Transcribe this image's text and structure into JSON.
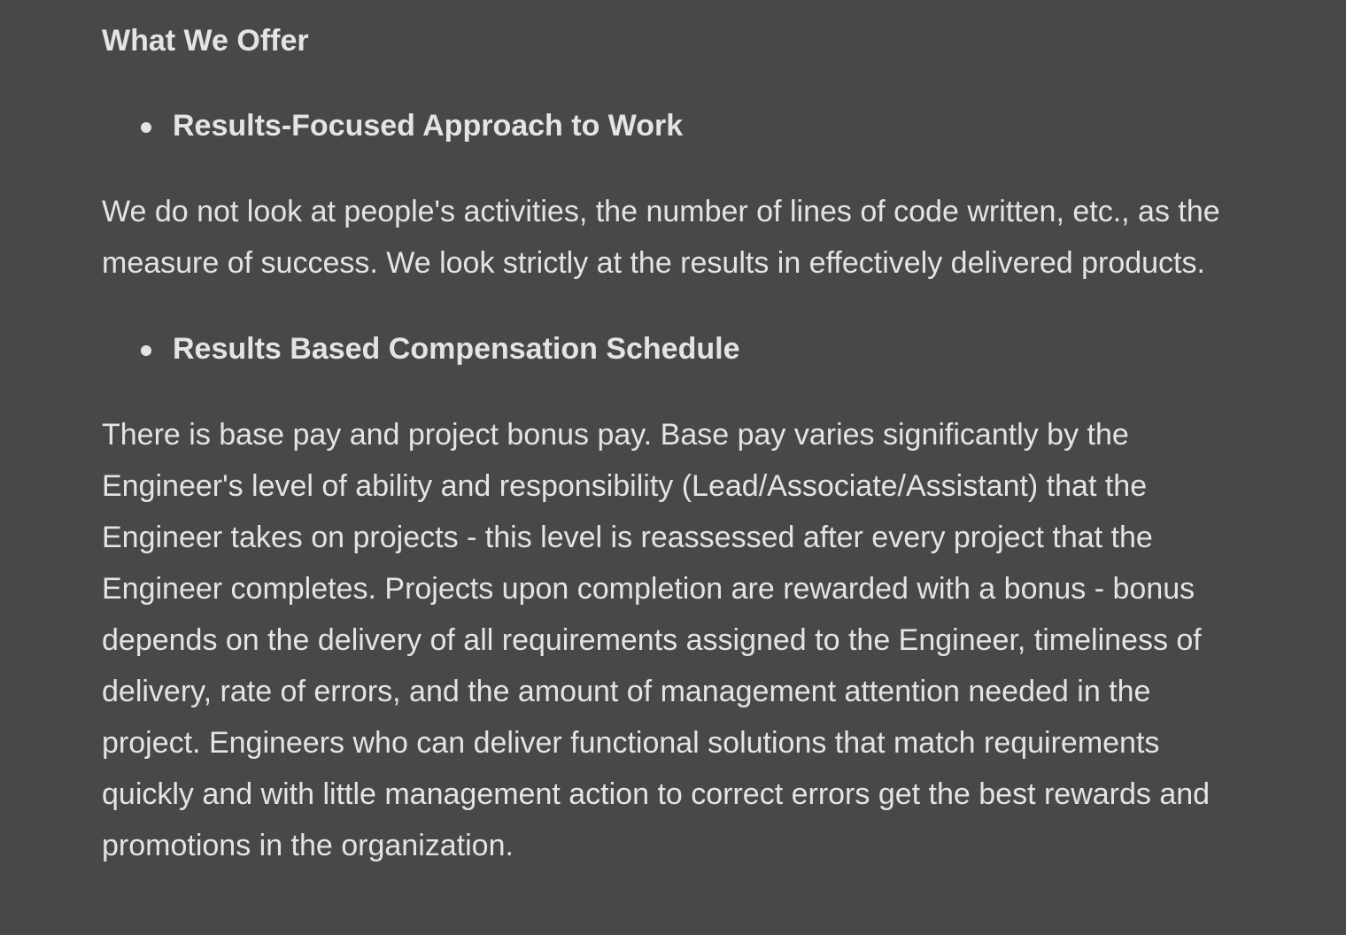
{
  "document": {
    "section_title": "What We Offer",
    "items": [
      {
        "heading": "Results-Focused Approach to Work",
        "paragraph": "We do not look at people's activities, the number of lines of code written, etc., as the measure of success. We look strictly at the results in effectively delivered products."
      },
      {
        "heading": "Results Based Compensation Schedule",
        "paragraph": "There is base pay and project bonus pay. Base pay varies significantly by the Engineer's level of ability and responsibility (Lead/Associate/Assistant) that the Engineer takes on projects - this level is reassessed after every project that the Engineer completes. Projects upon completion are rewarded with a bonus - bonus depends on the delivery of all requirements assigned to the Engineer, timeliness of delivery, rate of errors, and the amount of management attention needed in the project. Engineers who can deliver functional solutions that match requirements quickly and with little management action to correct errors get the best rewards and promotions in the organization."
      }
    ]
  },
  "colors": {
    "background": "#48484a",
    "text": "#e4e4e4"
  }
}
